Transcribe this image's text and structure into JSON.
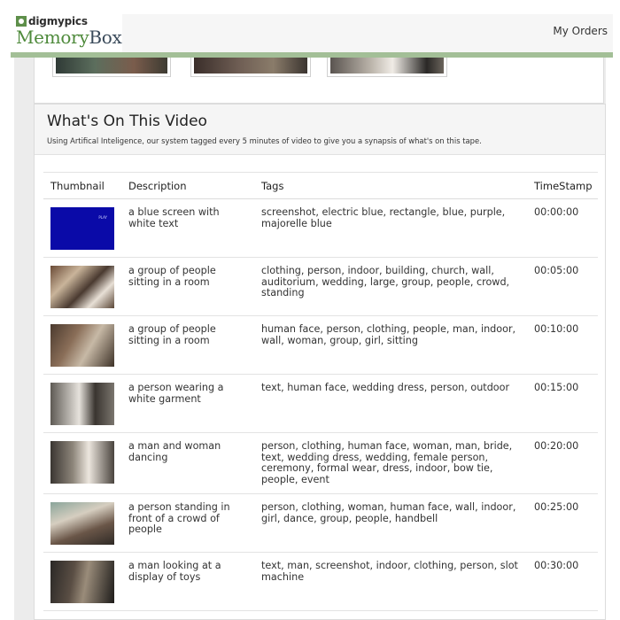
{
  "header": {
    "logo_top": "digmypics",
    "logo_main": "Memory",
    "logo_main_accent": "Box",
    "nav_link": "My Orders"
  },
  "section": {
    "title": "What's On This Video",
    "subtitle": "Using Artifical Inteligence, our system tagged every 5 minutes of video to give you a synapsis of what's on this tape."
  },
  "table": {
    "columns": [
      "Thumbnail",
      "Description",
      "Tags",
      "TimeStamp"
    ],
    "rows": [
      {
        "description": "a blue screen with white text",
        "tags": "screenshot, electric blue, rectangle, blue, purple, majorelle blue",
        "timestamp": "00:00:00"
      },
      {
        "description": "a group of people sitting in a room",
        "tags": "clothing, person, indoor, building, church, wall, auditorium, wedding, large, group, people, crowd, standing",
        "timestamp": "00:05:00"
      },
      {
        "description": "a group of people sitting in a room",
        "tags": "human face, person, clothing, people, man, indoor, wall, woman, group, girl, sitting",
        "timestamp": "00:10:00"
      },
      {
        "description": "a person wearing a white garment",
        "tags": "text, human face, wedding dress, person, outdoor",
        "timestamp": "00:15:00"
      },
      {
        "description": "a man and woman dancing",
        "tags": "person, clothing, human face, woman, man, bride, text, wedding dress, wedding, female person, ceremony, formal wear, dress, indoor, bow tie, people, event",
        "timestamp": "00:20:00"
      },
      {
        "description": "a person standing in front of a crowd of people",
        "tags": "person, clothing, woman, human face, wall, indoor, girl, dance, group, people, handbell",
        "timestamp": "00:25:00"
      },
      {
        "description": "a man looking at a display of toys",
        "tags": "text, man, screenshot, indoor, clothing, person, slot machine",
        "timestamp": "00:30:00"
      }
    ]
  }
}
